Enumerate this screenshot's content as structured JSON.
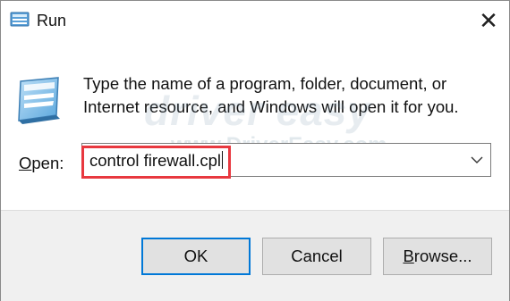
{
  "window": {
    "title": "Run",
    "close_glyph": "✕"
  },
  "description": "Type the name of a program, folder, document, or Internet resource, and Windows will open it for you.",
  "watermark": {
    "logo_text": "driver easy",
    "url_text": "www.DriverEasy.com"
  },
  "open": {
    "label_mnemonic": "O",
    "label_rest": "pen:",
    "value": "control firewall.cpl",
    "dropdown_icon": "chevron-down-icon"
  },
  "buttons": {
    "ok": "OK",
    "cancel": "Cancel",
    "browse_mnemonic": "B",
    "browse_rest": "rowse..."
  },
  "colors": {
    "highlight": "#e8383f",
    "accent": "#0078d7"
  }
}
